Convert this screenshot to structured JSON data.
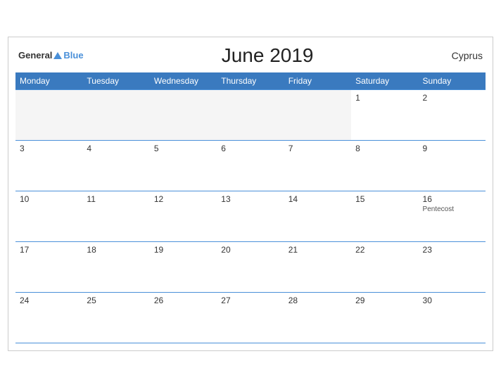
{
  "header": {
    "logo_general": "General",
    "logo_blue": "Blue",
    "title": "June 2019",
    "country": "Cyprus"
  },
  "weekdays": [
    "Monday",
    "Tuesday",
    "Wednesday",
    "Thursday",
    "Friday",
    "Saturday",
    "Sunday"
  ],
  "weeks": [
    [
      {
        "day": "",
        "event": "",
        "empty": true
      },
      {
        "day": "",
        "event": "",
        "empty": true
      },
      {
        "day": "",
        "event": "",
        "empty": true
      },
      {
        "day": "",
        "event": "",
        "empty": true
      },
      {
        "day": "",
        "event": "",
        "empty": true
      },
      {
        "day": "1",
        "event": ""
      },
      {
        "day": "2",
        "event": ""
      }
    ],
    [
      {
        "day": "3",
        "event": ""
      },
      {
        "day": "4",
        "event": ""
      },
      {
        "day": "5",
        "event": ""
      },
      {
        "day": "6",
        "event": ""
      },
      {
        "day": "7",
        "event": ""
      },
      {
        "day": "8",
        "event": ""
      },
      {
        "day": "9",
        "event": ""
      }
    ],
    [
      {
        "day": "10",
        "event": ""
      },
      {
        "day": "11",
        "event": ""
      },
      {
        "day": "12",
        "event": ""
      },
      {
        "day": "13",
        "event": ""
      },
      {
        "day": "14",
        "event": ""
      },
      {
        "day": "15",
        "event": ""
      },
      {
        "day": "16",
        "event": "Pentecost"
      }
    ],
    [
      {
        "day": "17",
        "event": ""
      },
      {
        "day": "18",
        "event": ""
      },
      {
        "day": "19",
        "event": ""
      },
      {
        "day": "20",
        "event": ""
      },
      {
        "day": "21",
        "event": ""
      },
      {
        "day": "22",
        "event": ""
      },
      {
        "day": "23",
        "event": ""
      }
    ],
    [
      {
        "day": "24",
        "event": ""
      },
      {
        "day": "25",
        "event": ""
      },
      {
        "day": "26",
        "event": ""
      },
      {
        "day": "27",
        "event": ""
      },
      {
        "day": "28",
        "event": ""
      },
      {
        "day": "29",
        "event": ""
      },
      {
        "day": "30",
        "event": ""
      }
    ]
  ]
}
